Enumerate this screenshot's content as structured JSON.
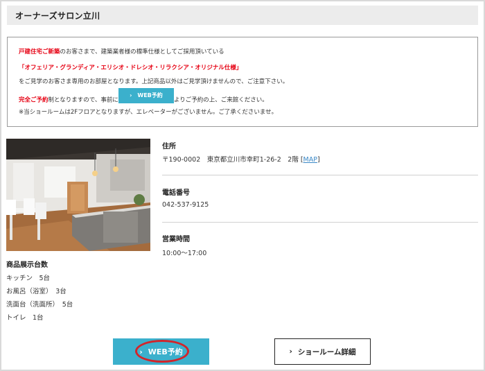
{
  "header": {
    "title": "オーナーズサロン立川"
  },
  "notice": {
    "line1_red": "戸建住宅ご新築",
    "line1_rest": "のお客さまで、建築業者様の標準仕様としてご採用頂いている",
    "line2_red": "「オフェリア・グランディア・エリシオ・ドレシオ・リラクシア・オリジナル仕様」",
    "line3": "をご見学のお客さま専用のお部屋となります。上記商品以外はご見学頂けませんので、ご注意下さい。",
    "line4_red": "完全ご予約",
    "line4_mid": "制となりますので、事前に",
    "line4_button": "WEB予約",
    "line4_end": "よりご予約の上、ご来館ください。",
    "line5": "※当ショールームは2Fフロアとなりますが、エレベーターがございません。ご了承くださいませ。"
  },
  "info": {
    "address_label": "住所",
    "address_value": "〒190-0002　東京都立川市幸町1-26-2　2階 [",
    "map_link": "MAP",
    "address_close": "]",
    "phone_label": "電話番号",
    "phone_value": "042-537-9125",
    "hours_label": "営業時間",
    "hours_value": "10:00〜17:00"
  },
  "showroom": {
    "title": "商品展示台数",
    "items": [
      "キッチン　5台",
      "お風呂（浴室）　3台",
      "洗面台（洗面所）　5台",
      "トイレ　1台"
    ]
  },
  "buttons": {
    "web": "WEB予約",
    "detail": "ショールーム詳細"
  },
  "colors": {
    "accent": "#3bb0cc",
    "alert": "#e60012",
    "highlight_oval": "#d3242a"
  }
}
